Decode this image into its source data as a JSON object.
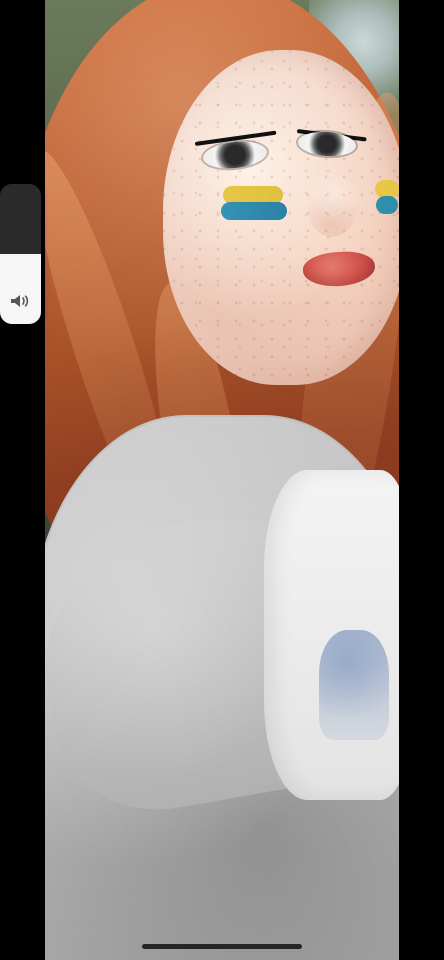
{
  "screen": {
    "background": "#000000"
  },
  "photo": {
    "content": "selfie-photo"
  },
  "volume_hud": {
    "level_fraction": 0.5,
    "icon": "speaker-volume-icon"
  },
  "home_indicator": {
    "icon": "home-indicator"
  },
  "colors": {
    "hud_dark": "#2b2b2b",
    "hud_light": "#f6f6f6",
    "home_indicator": "#1a1a1a"
  }
}
